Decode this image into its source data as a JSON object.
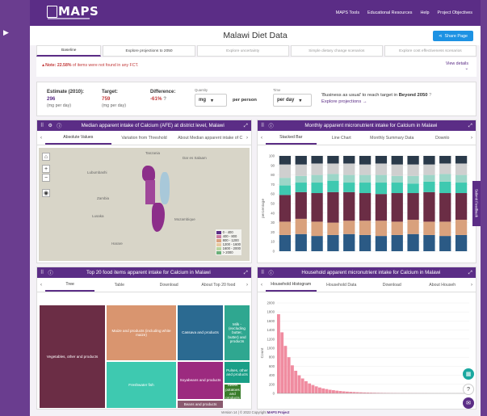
{
  "nav": {
    "logo": "MAPS",
    "links": [
      "MAPS Tools",
      "Educational Resources",
      "Help",
      "Project Objectives"
    ]
  },
  "header": {
    "title": "Malawi Diet Data",
    "share_label": "Share Page"
  },
  "tabs": [
    {
      "label": "Baseline",
      "state": "active"
    },
    {
      "label": "Explore projections to 2050",
      "state": "normal"
    },
    {
      "label": "Explore uncertainty",
      "state": "disabled"
    },
    {
      "label": "Simple dietary change scenarios",
      "state": "disabled"
    },
    {
      "label": "Explore cost effectiveness scenarios",
      "state": "disabled"
    }
  ],
  "note": {
    "prefix": "Note: ",
    "percent": "22.58%",
    "text": " of items were not found in any FCT.",
    "details_label": "View details"
  },
  "stats": {
    "estimate_label": "Estimate (2010):",
    "estimate_value": "296",
    "estimate_unit": "(mg per day)",
    "target_label": "Target:",
    "target_value": "759",
    "target_unit": "(mg per day)",
    "difference_label": "Difference:",
    "difference_value": "-61%",
    "quantity_label": "Quantity",
    "quantity_value": "mg",
    "per_person": "per person",
    "time_label": "Time",
    "time_value": "per day",
    "bau_text": "'Business as usual' to reach target in",
    "bau_year": "Beyond 2050",
    "explore_link": "Explore projections →"
  },
  "panels": {
    "map": {
      "title": "Median apparent intake of Calcium (AFE) at district level, Malawi",
      "tabs": [
        "Absolute Values",
        "Variation from Threshold",
        "About Median apparent intake of C"
      ],
      "legend": [
        {
          "range": "0 - 400",
          "color": "#5b2d86"
        },
        {
          "range": "400 - 800",
          "color": "#c97aa0"
        },
        {
          "range": "800 - 1200",
          "color": "#d9a17d"
        },
        {
          "range": "1200 - 1600",
          "color": "#e8c9a0"
        },
        {
          "range": "1600 - 2000",
          "color": "#b9d6a0"
        },
        {
          "range": "> 2000",
          "color": "#6cb07a"
        }
      ],
      "place_labels": [
        "Tanzania",
        "Dar es Salaam",
        "Zambia",
        "Lusaka",
        "Mozambique",
        "Harare",
        "Lubumbashi"
      ]
    },
    "monthly": {
      "title": "Monthly apparent micronutrient intake for Calcium in Malawi",
      "tabs": [
        "Stacked Bar",
        "Line Chart",
        "Monthly Summary Data",
        "Downlo"
      ],
      "ylabel": "percentage",
      "yticks": [
        "0",
        "10",
        "20",
        "30",
        "40",
        "50",
        "60",
        "70",
        "80",
        "90",
        "100"
      ]
    },
    "top20": {
      "title": "Top 20 food items apparent intake for Calcium in Malawi",
      "tabs": [
        "Tree",
        "Table",
        "Download",
        "About Top 20 food"
      ],
      "tiles": [
        {
          "label": "Vegetables, other and products",
          "color": "#6b2d45"
        },
        {
          "label": "Maize and products (including white maize)",
          "color": "#d9956f"
        },
        {
          "label": "Freshwater fish",
          "color": "#3ec9b0"
        },
        {
          "label": "Cassava and products",
          "color": "#2b6a91"
        },
        {
          "label": "Milk - (excluding butter, butter) and products",
          "color": "#2fa790"
        },
        {
          "label": "Soyabeans and products",
          "color": "#9c2a7f"
        },
        {
          "label": "Pulses, other and products",
          "color": "#1a9f87"
        },
        {
          "label": "Sweet potatoes and products",
          "color": "#3a7d2c"
        },
        {
          "label": "Beans and products",
          "color": "#8a5a6f"
        }
      ]
    },
    "household": {
      "title": "Household apparent micronutrient intake for Calcium in Malawi",
      "tabs": [
        "Household Histogram",
        "Household Data",
        "Download",
        "About Househ"
      ],
      "ylabel": "Count",
      "yticks": [
        "0",
        "200",
        "400",
        "600",
        "800",
        "1000",
        "1200",
        "1400",
        "1600",
        "1800",
        "2000"
      ]
    }
  },
  "feedback_label": "Submit Feedback",
  "footer": {
    "prefix": "Version 14 | © 2022 Copyright",
    "org": "MAPS Project"
  },
  "chart_data": [
    {
      "type": "bar",
      "ylabel": "percentage",
      "ylim": [
        0,
        100
      ],
      "stacked": true,
      "series_colors": [
        "#2b5a85",
        "#d9a17d",
        "#6b2d45",
        "#3ec9b0",
        "#9cd6c8",
        "#cfcfcf",
        "#2a3a4a"
      ],
      "bars": [
        [
          17,
          14,
          28,
          10,
          8,
          14,
          9
        ],
        [
          18,
          16,
          28,
          10,
          7,
          12,
          9
        ],
        [
          16,
          15,
          30,
          11,
          8,
          12,
          8
        ],
        [
          17,
          13,
          32,
          12,
          7,
          11,
          8
        ],
        [
          18,
          14,
          30,
          10,
          8,
          12,
          8
        ],
        [
          17,
          15,
          29,
          11,
          8,
          11,
          9
        ],
        [
          16,
          16,
          28,
          12,
          8,
          12,
          8
        ],
        [
          17,
          14,
          30,
          11,
          7,
          12,
          9
        ],
        [
          18,
          15,
          28,
          10,
          8,
          12,
          9
        ],
        [
          17,
          14,
          31,
          11,
          7,
          11,
          9
        ],
        [
          16,
          15,
          30,
          12,
          8,
          11,
          8
        ],
        [
          17,
          16,
          28,
          11,
          8,
          12,
          8
        ]
      ]
    },
    {
      "type": "bar",
      "ylabel": "Count",
      "ylim": [
        0,
        2000
      ],
      "color": "#f08ca0",
      "values": [
        1750,
        1350,
        1050,
        800,
        620,
        500,
        400,
        330,
        270,
        220,
        185,
        155,
        130,
        110,
        95,
        80,
        70,
        60,
        52,
        45,
        39,
        34,
        30,
        26,
        23,
        20,
        18,
        16,
        14,
        12,
        11,
        10,
        9,
        8,
        7,
        6,
        6,
        5,
        5,
        4,
        4,
        3,
        3,
        3,
        2,
        2,
        2,
        2,
        1,
        1,
        1,
        1,
        1,
        1,
        1,
        1
      ]
    }
  ]
}
